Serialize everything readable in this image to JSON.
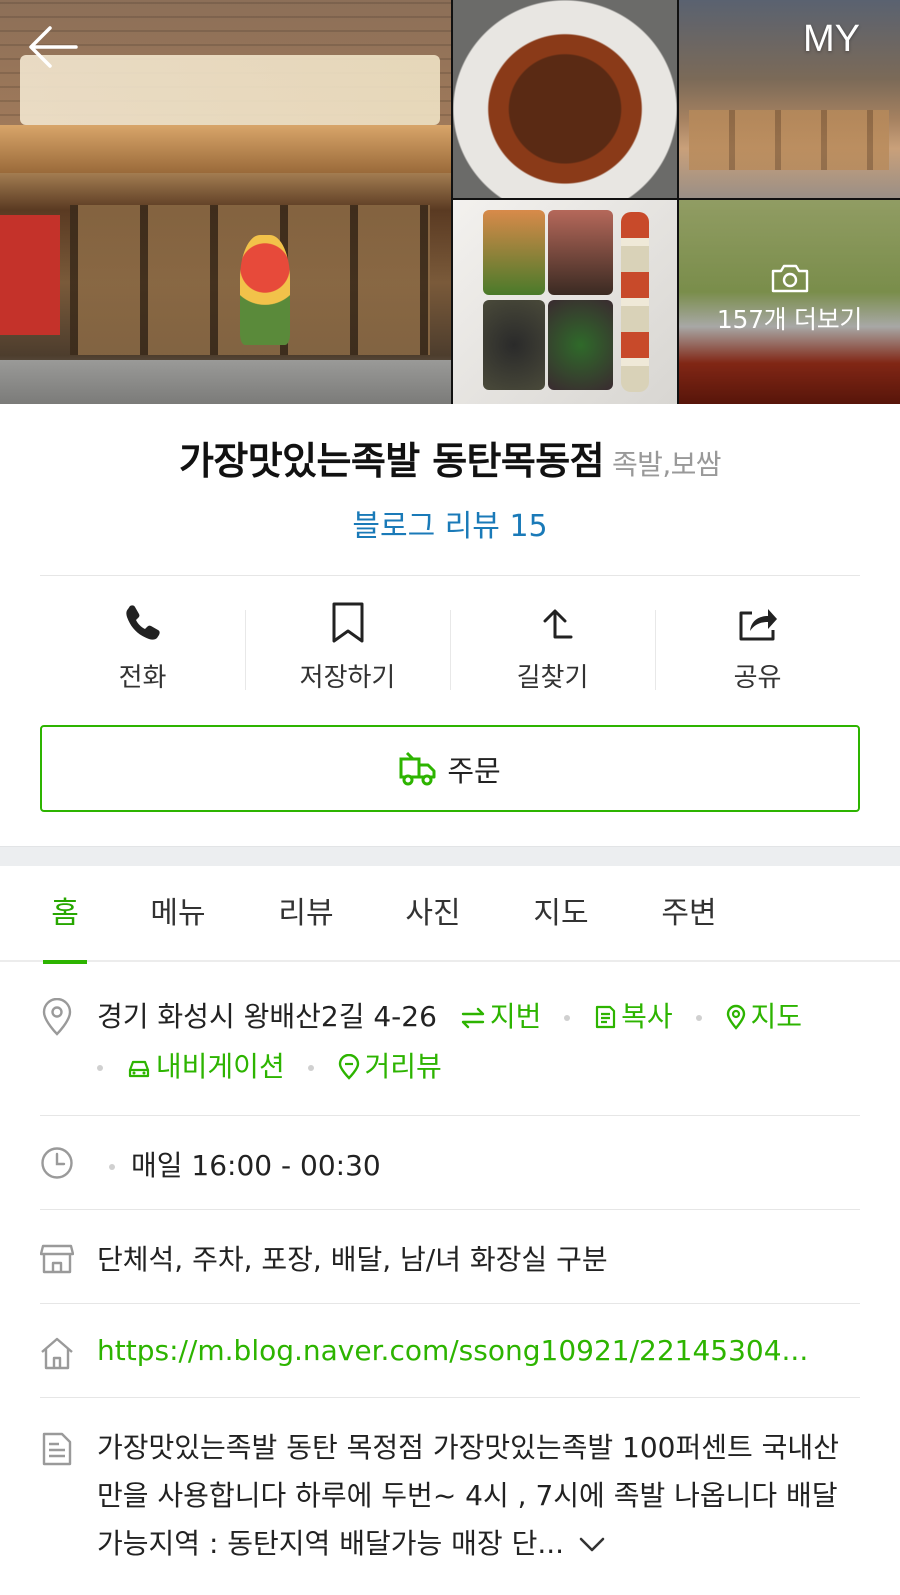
{
  "header": {
    "my_label": "MY",
    "more_photos_label": "157개 더보기"
  },
  "place": {
    "name": "가장맛있는족발 동탄목동점",
    "category": "족발,보쌈",
    "blog_review": "블로그 리뷰 15"
  },
  "actions": [
    {
      "label": "전화",
      "icon": "phone-icon"
    },
    {
      "label": "저장하기",
      "icon": "bookmark-icon"
    },
    {
      "label": "길찾기",
      "icon": "directions-icon"
    },
    {
      "label": "공유",
      "icon": "share-icon"
    }
  ],
  "order": {
    "label": "주문",
    "icon": "delivery-truck-icon"
  },
  "tabs": [
    {
      "label": "홈",
      "active": true
    },
    {
      "label": "메뉴",
      "active": false
    },
    {
      "label": "리뷰",
      "active": false
    },
    {
      "label": "사진",
      "active": false
    },
    {
      "label": "지도",
      "active": false
    },
    {
      "label": "주변",
      "active": false
    }
  ],
  "info": {
    "address": "경기 화성시 왕배산2길 4-26",
    "address_links": {
      "lot_number": "지번",
      "copy": "복사",
      "map": "지도",
      "navigation": "내비게이션",
      "street_view": "거리뷰"
    },
    "hours": "매일 16:00 - 00:30",
    "facilities": "단체석, 주차, 포장, 배달, 남/녀 화장실 구분",
    "website": "https://m.blog.naver.com/ssong10921/22145304...",
    "description": "가장맛있는족발 동탄 목정점 가장맛있는족발 100퍼센트 국내산만을 사용합니다 하루에 두번~ 4시 , 7시에 족발 나옵니다 배달 가능지역 : 동탄지역 배달가능 매장 단..."
  },
  "colors": {
    "accent_green": "#2db400",
    "link_blue": "#1a7ab8"
  }
}
